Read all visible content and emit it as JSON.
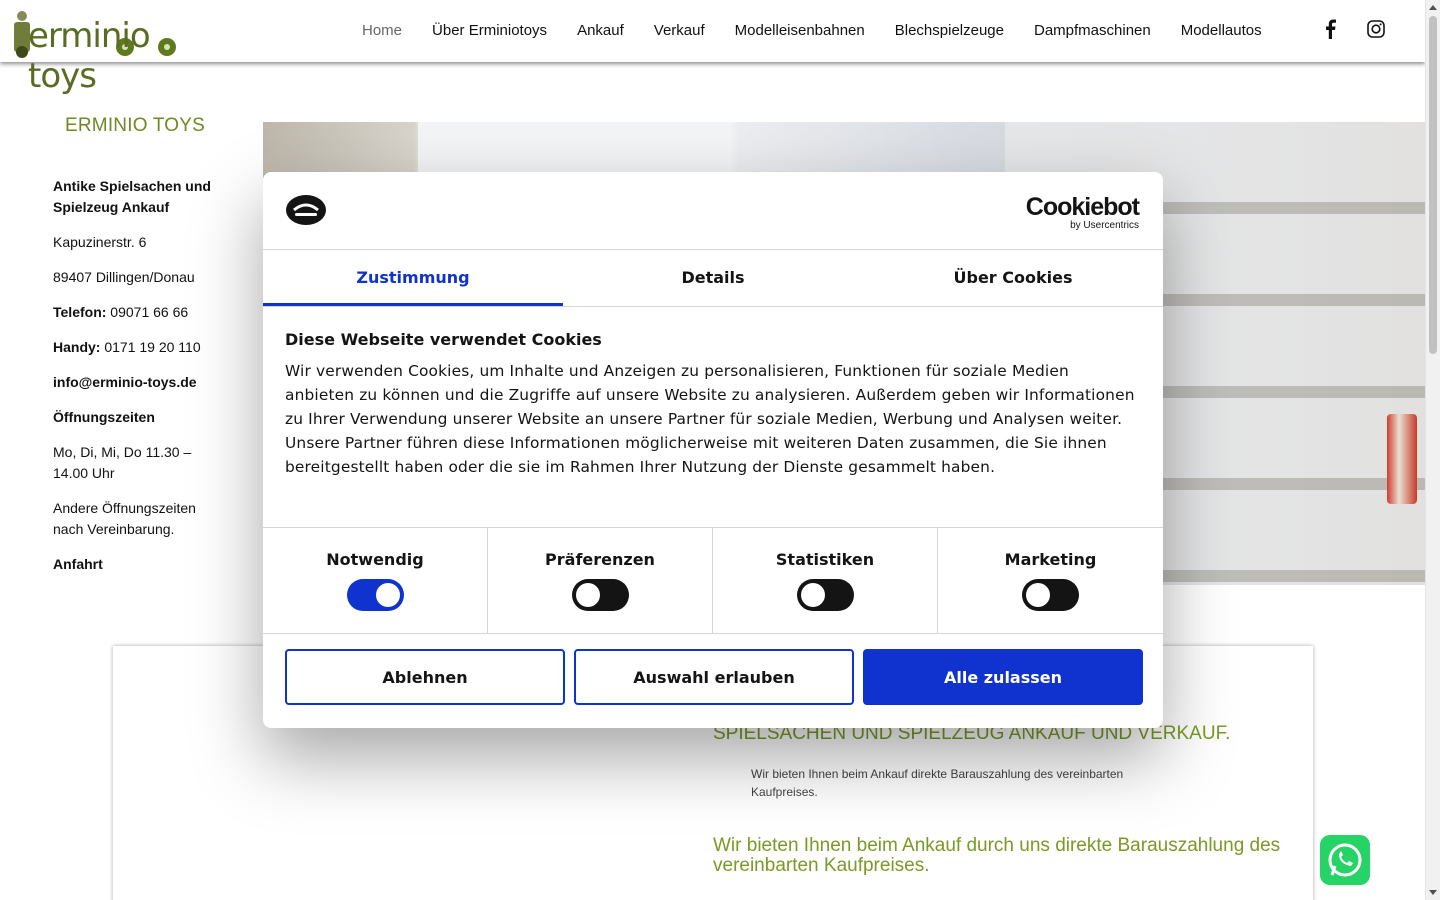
{
  "header": {
    "logo_text": "erminio toys",
    "nav": [
      "Home",
      "Über Erminiotoys",
      "Ankauf",
      "Verkauf",
      "Modelleisenbahnen",
      "Blechspielzeuge",
      "Dampfmaschinen",
      "Modellautos"
    ],
    "social": [
      "facebook-icon",
      "instagram-icon"
    ]
  },
  "sidebar": {
    "title": "ERMINIO TOYS",
    "heading": "Antike Spielsachen und Spielzeug Ankauf",
    "street": "Kapuzinerstr. 6",
    "city": "89407 Dillingen/Donau",
    "phone_label": "Telefon:",
    "phone": " 09071 66 66",
    "mobile_label": "Handy:",
    "mobile": " 0171 19 20 110",
    "email": "info@erminio-toys.de",
    "hours_label": "Öffnungszeiten",
    "hours": "Mo, Di, Mi, Do 11.30 – 14.00 Uhr",
    "hours_other": "Andere Öffnungszeiten nach Vereinbarung.",
    "directions": "Anfahrt"
  },
  "content": {
    "heading_1": "SPIELSACHEN UND SPIELZEUG ANKAUF UND VERKAUF.",
    "small_text": "Wir bieten Ihnen beim Ankauf direkte Barauszahlung des vereinbarten Kaufpreises.",
    "heading_2": "Wir bieten Ihnen beim Ankauf durch uns direkte Barauszahlung des vereinbarten Kaufpreises."
  },
  "cookie": {
    "brand": "Cookiebot",
    "brand_sub": "by Usercentrics",
    "tabs": [
      "Zustimmung",
      "Details",
      "Über Cookies"
    ],
    "title": "Diese Webseite verwendet Cookies",
    "text": "Wir verwenden Cookies, um Inhalte und Anzeigen zu personalisieren, Funktionen für soziale Medien anbieten zu können und die Zugriffe auf unsere Website zu analysieren. Außerdem geben wir Informationen zu Ihrer Verwendung unserer Website an unsere Partner für soziale Medien, Werbung und Analysen weiter. Unsere Partner führen diese Informationen möglicherweise mit weiteren Daten zusammen, die Sie ihnen bereitgestellt haben oder die sie im Rahmen Ihrer Nutzung der Dienste gesammelt haben.",
    "toggles": [
      {
        "label": "Notwendig",
        "on": true
      },
      {
        "label": "Präferenzen",
        "on": false
      },
      {
        "label": "Statistiken",
        "on": false
      },
      {
        "label": "Marketing",
        "on": false
      }
    ],
    "buttons": {
      "decline": "Ablehnen",
      "allow_selection": "Auswahl erlauben",
      "allow_all": "Alle zulassen"
    },
    "accent": "#1032cf"
  }
}
